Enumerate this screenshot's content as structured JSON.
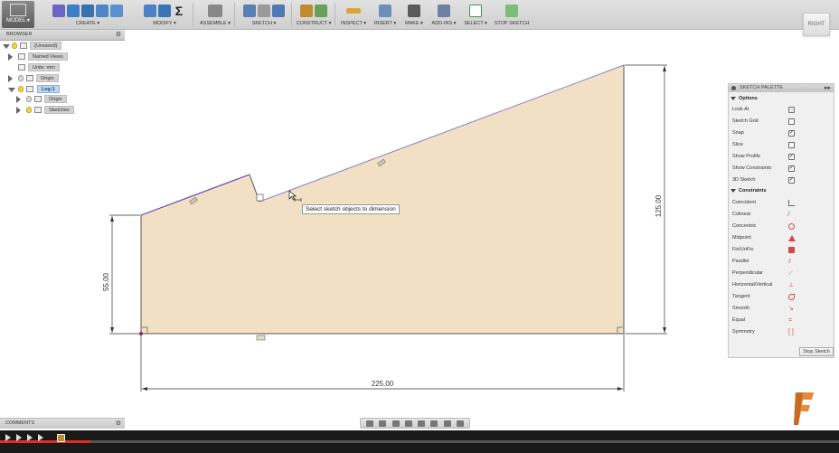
{
  "toolbar": {
    "model_label": "MODEL ▾",
    "groups": {
      "create": "CREATE ▾",
      "modify": "MODIFY ▾",
      "assemble": "ASSEMBLE ▾",
      "sketch": "SKETCH ▾",
      "construct": "CONSTRUCT ▾",
      "inspect": "INSPECT ▾",
      "insert": "INSERT ▾",
      "make": "MAKE ▾",
      "addins": "ADD-INS ▾",
      "select": "SELECT ▾",
      "stop_sketch": "STOP SKETCH"
    }
  },
  "viewcube": {
    "label": "RIGHT"
  },
  "browser": {
    "title": "BROWSER",
    "close": "⚙",
    "items": [
      {
        "label": "(Unsaved)"
      },
      {
        "label": "Named Views"
      },
      {
        "label": "Units: mm"
      },
      {
        "label": "Origin"
      },
      {
        "label": "Leg:1"
      },
      {
        "label": "Origin"
      },
      {
        "label": "Sketches"
      }
    ]
  },
  "canvas": {
    "tooltip": "Select sketch objects to dimension",
    "dimensions": {
      "left_height": "55.00",
      "right_height": "125.00",
      "bottom_width": "225.00"
    }
  },
  "palette": {
    "title": "SKETCH PALETTE",
    "expand": "▸▸",
    "options_header": "Options",
    "options": [
      {
        "label": "Look At",
        "icon": "look-at-icon"
      },
      {
        "label": "Sketch Grid",
        "icon": "checkbox-unchecked",
        "checked": false
      },
      {
        "label": "Snap",
        "icon": "checkbox-checked",
        "checked": true
      },
      {
        "label": "Slice",
        "icon": "checkbox-unchecked",
        "checked": false
      },
      {
        "label": "Show Profile",
        "icon": "checkbox-checked",
        "checked": true
      },
      {
        "label": "Show Constraints",
        "icon": "checkbox-checked",
        "checked": true
      },
      {
        "label": "3D Sketch",
        "icon": "checkbox-checked",
        "checked": true
      }
    ],
    "constraints_header": "Constraints",
    "constraints": [
      {
        "label": "Coincident",
        "icon": "coincident-icon"
      },
      {
        "label": "Colinear",
        "icon": "colinear-icon"
      },
      {
        "label": "Concentric",
        "icon": "concentric-icon"
      },
      {
        "label": "Midpoint",
        "icon": "midpoint-icon"
      },
      {
        "label": "Fix/UnFix",
        "icon": "lock-icon"
      },
      {
        "label": "Parallel",
        "icon": "parallel-icon"
      },
      {
        "label": "Perpendicular",
        "icon": "perpendicular-icon"
      },
      {
        "label": "Horizontal/Vertical",
        "icon": "horizontal-vertical-icon"
      },
      {
        "label": "Tangent",
        "icon": "tangent-icon"
      },
      {
        "label": "Smooth",
        "icon": "smooth-icon"
      },
      {
        "label": "Equal",
        "icon": "equal-icon"
      },
      {
        "label": "Symmetry",
        "icon": "symmetry-icon"
      }
    ],
    "stop_sketch": "Stop Sketch"
  },
  "comments": {
    "title": "COMMENTS",
    "close": "⚙"
  },
  "video": {
    "progress_fraction": 0.108
  },
  "colors": {
    "profile_fill": "#f2e0c4",
    "sketch_line": "#5a5a5a",
    "selected_line": "#6a4fc8",
    "accent_red": "#e52d27"
  }
}
